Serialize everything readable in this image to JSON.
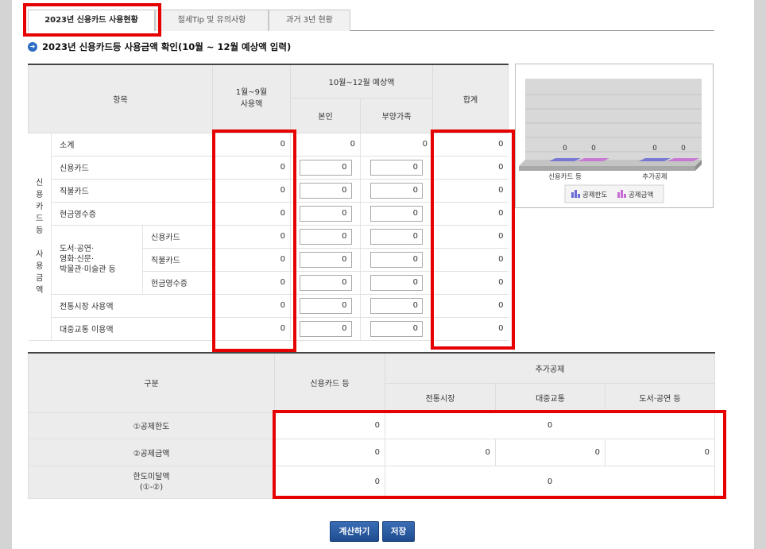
{
  "tabs": [
    {
      "label": "2023년 신용카드 사용현황",
      "active": true
    },
    {
      "label": "절세Tip 및 유의사항",
      "active": false
    },
    {
      "label": "과거 3년 현황",
      "active": false
    }
  ],
  "section_title": "2023년 신용카드등 사용금액 확인(10월 ~ 12월 예상액 입력)",
  "table1": {
    "headers": {
      "item": "항목",
      "jan_sep": "1월~9월\n사용액",
      "oct_dec": "10월~12월 예상액",
      "self": "본인",
      "dependents": "부양가족",
      "total": "합계"
    },
    "group_label": "신\n용\n카\n드\n등\n\n사\n용\n금\n액",
    "subgroup_label": "도서·공연·\n영화·신문·\n박물관·미술관 등",
    "rows": [
      {
        "label": "소계",
        "sub": "",
        "jan_sep": "0",
        "self": "0",
        "dep": "0",
        "total": "0"
      },
      {
        "label": "신용카드",
        "sub": "",
        "jan_sep": "0",
        "self": "0",
        "dep": "0",
        "total": "0"
      },
      {
        "label": "직불카드",
        "sub": "",
        "jan_sep": "0",
        "self": "0",
        "dep": "0",
        "total": "0"
      },
      {
        "label": "현금영수증",
        "sub": "",
        "jan_sep": "0",
        "self": "0",
        "dep": "0",
        "total": "0"
      },
      {
        "label": "",
        "sub": "신용카드",
        "jan_sep": "0",
        "self": "0",
        "dep": "0",
        "total": "0"
      },
      {
        "label": "",
        "sub": "직불카드",
        "jan_sep": "0",
        "self": "0",
        "dep": "0",
        "total": "0"
      },
      {
        "label": "",
        "sub": "현금영수증",
        "jan_sep": "0",
        "self": "0",
        "dep": "0",
        "total": "0"
      },
      {
        "label": "전통시장 사용액",
        "sub": "",
        "jan_sep": "0",
        "self": "0",
        "dep": "0",
        "total": "0"
      },
      {
        "label": "대중교통 이용액",
        "sub": "",
        "jan_sep": "0",
        "self": "0",
        "dep": "0",
        "total": "0"
      }
    ]
  },
  "chart_data": {
    "type": "bar",
    "categories": [
      "신용카드 등",
      "추가공제"
    ],
    "series": [
      {
        "name": "공제한도",
        "values": [
          0,
          0
        ],
        "color": "#6b6bd6"
      },
      {
        "name": "공제금액",
        "values": [
          0,
          0
        ],
        "color": "#c86bd6"
      }
    ],
    "data_labels": [
      "0",
      "0",
      "0",
      "0"
    ],
    "legend": "bottom",
    "grid": true
  },
  "table2": {
    "headers": {
      "division": "구분",
      "credit": "신용카드 등",
      "extra": "추가공제",
      "market": "전통시장",
      "transit": "대중교통",
      "books": "도서·공연 등"
    },
    "rows": [
      {
        "label": "①공제한도",
        "credit": "0",
        "extra": "0"
      },
      {
        "label": "②공제금액",
        "credit": "0",
        "market": "0",
        "transit": "0",
        "books": "0"
      },
      {
        "label": "한도미달액\n(①-②)",
        "credit": "0",
        "extra": "0"
      }
    ]
  },
  "buttons": {
    "calc": "계산하기",
    "save": "저장"
  }
}
